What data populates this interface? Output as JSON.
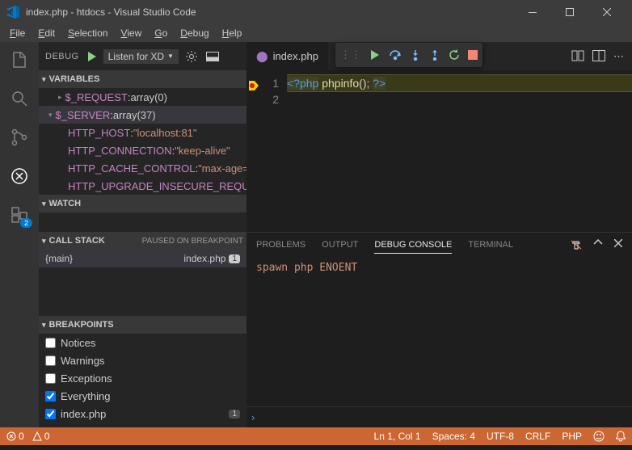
{
  "window": {
    "title": "index.php - htdocs - Visual Studio Code"
  },
  "menu": [
    "File",
    "Edit",
    "Selection",
    "View",
    "Go",
    "Debug",
    "Help"
  ],
  "debugHeader": {
    "label": "DEBUG",
    "config": "Listen for XD"
  },
  "sections": {
    "variables": "VARIABLES",
    "watch": "WATCH",
    "callstack": "CALL STACK",
    "callstackStatus": "PAUSED ON BREAKPOINT",
    "breakpoints": "BREAKPOINTS"
  },
  "variables": [
    {
      "indent": 24,
      "tw": "▸",
      "name": "$_REQUEST",
      "sep": ": ",
      "val": "array(0)"
    },
    {
      "indent": 12,
      "tw": "▾",
      "name": "$_SERVER",
      "sep": ": ",
      "val": "array(37)",
      "selected": true
    },
    {
      "indent": 36,
      "name": "HTTP_HOST",
      "sep": ": ",
      "str": "\"localhost:81\""
    },
    {
      "indent": 36,
      "name": "HTTP_CONNECTION",
      "sep": ": ",
      "str": "\"keep-alive\""
    },
    {
      "indent": 36,
      "name": "HTTP_CACHE_CONTROL",
      "sep": ": ",
      "str": "\"max-age=…"
    },
    {
      "indent": 36,
      "name": "HTTP_UPGRADE_INSECURE_REQUEST…"
    }
  ],
  "callstack": {
    "frame": "{main}",
    "file": "index.php",
    "line": "1"
  },
  "breakpoints": [
    {
      "label": "Notices",
      "checked": false
    },
    {
      "label": "Warnings",
      "checked": false
    },
    {
      "label": "Exceptions",
      "checked": false
    },
    {
      "label": "Everything",
      "checked": true
    },
    {
      "label": "index.php",
      "checked": true,
      "line": "1"
    }
  ],
  "tab": {
    "label": "index.php"
  },
  "code": {
    "line1_open": "<?php",
    "line1_fn": " phpinfo",
    "line1_rest": "(); ",
    "line1_close": "?>",
    "ln1": "1",
    "ln2": "2"
  },
  "panel": {
    "tabs": {
      "problems": "PROBLEMS",
      "output": "OUTPUT",
      "debug": "DEBUG CONSOLE",
      "terminal": "TERMINAL"
    },
    "output": "spawn php ENOENT",
    "prompt": "›"
  },
  "status": {
    "errors": "0",
    "warnings": "0",
    "lncol": "Ln 1, Col 1",
    "spaces": "Spaces: 4",
    "encoding": "UTF-8",
    "eol": "CRLF",
    "lang": "PHP"
  },
  "badge": "2"
}
